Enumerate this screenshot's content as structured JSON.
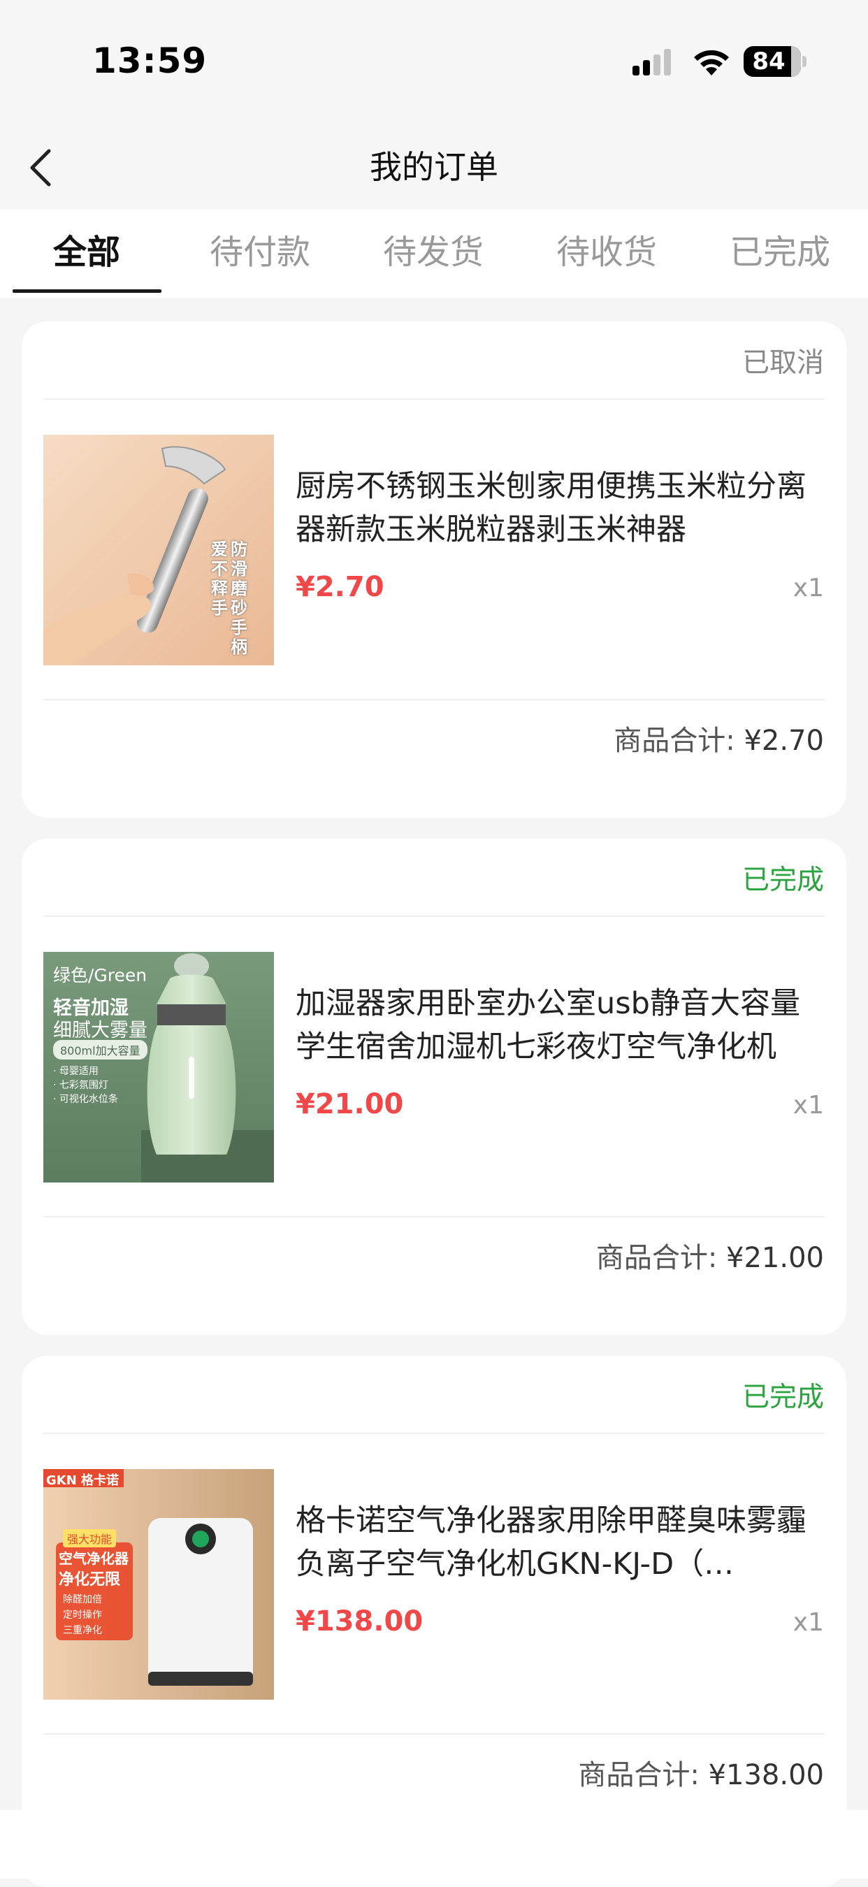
{
  "status_bar": {
    "time": "13:59",
    "battery": "84"
  },
  "nav": {
    "title": "我的订单"
  },
  "tabs": [
    {
      "label": "全部",
      "active": true
    },
    {
      "label": "待付款",
      "active": false
    },
    {
      "label": "待发货",
      "active": false
    },
    {
      "label": "待收货",
      "active": false
    },
    {
      "label": "已完成",
      "active": false
    }
  ],
  "orders": [
    {
      "status": "已取消",
      "title": "厨房不锈钢玉米刨家用便携玉米粒分离器新款玉米脱粒器剥玉米神器",
      "price": "¥2.70",
      "qty": "x1",
      "total_label": "商品合计:",
      "total_value": "¥2.70",
      "image_text": {
        "line1": "防滑磨砂手柄",
        "line2": "爱不释手"
      }
    },
    {
      "status": "已完成",
      "title": "加湿器家用卧室办公室usb静音大容量学生宿舍加湿机七彩夜灯空气净化机",
      "price": "¥21.00",
      "qty": "x1",
      "total_label": "商品合计:",
      "total_value": "¥21.00",
      "image_text": {
        "color": "绿色/Green",
        "headline1": "轻音加湿",
        "headline2": "细腻大雾量",
        "badge": "800ml加大容量",
        "bullet1": "· 母婴适用",
        "bullet2": "· 七彩氛围灯",
        "bullet3": "· 可视化水位条"
      }
    },
    {
      "status": "已完成",
      "title": "格卡诺空气净化器家用除甲醛臭味雾霾负离子空气净化机GKN-KJ-D（…",
      "price": "¥138.00",
      "qty": "x1",
      "total_label": "商品合计:",
      "total_value": "¥138.00",
      "image_text": {
        "brand": "GKN 格卡诺",
        "tag1": "强大功能",
        "tag2": "空气净化器",
        "tag3": "净化无限",
        "f1": "除醛加倍",
        "f2": "定时操作",
        "f3": "三重净化"
      }
    }
  ],
  "colors": {
    "price_red": "#f04848",
    "done_green": "#2ba33f",
    "cancel_gray": "#888888"
  }
}
